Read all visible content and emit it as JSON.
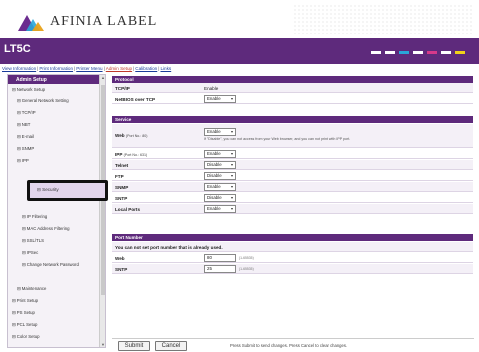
{
  "brand": {
    "name": "AFINIA LABEL"
  },
  "colors": {
    "primary": "#5e2a7c",
    "link": "#1a3c9a",
    "active_link": "#c0392b"
  },
  "header": {
    "model": "LT5C"
  },
  "nav": {
    "links": [
      "View Information",
      "Print Information",
      "Printer Menu",
      "Admin Setup",
      "Calibration",
      "Links"
    ],
    "active_index": 3
  },
  "sidebar": {
    "title": "Admin Setup",
    "items": [
      "⊟ Network Setup",
      "⊟ General Network Setting",
      "⊟ TCP/IP",
      "⊟ NBT",
      "⊟ E-mail",
      "⊟ SNMP",
      "⊟ IPP",
      "⊟ Security",
      "⊟ IP Filtering",
      "⊟ MAC Address Filtering",
      "⊟ SSL/TLS",
      "⊟ IPSec",
      "⊟ Change Network Password",
      "⊟ Maintenance",
      "⊟ Print Setup",
      "⊟ PS Setup",
      "⊟ PCL Setup",
      "⊟ Color Setup"
    ]
  },
  "protocol": {
    "title": "Protocol",
    "rows": [
      {
        "label": "TCP/IP",
        "value": "Enable"
      },
      {
        "label": "NetBIOS over TCP",
        "value": "Enable"
      }
    ]
  },
  "service": {
    "title": "Service",
    "web": {
      "label": "Web",
      "sub": "(Port No.: 80)",
      "value": "Enable",
      "note": "If \"Disable\", you can not access from your Web browser, and you can not print with IPP port."
    },
    "ipp": {
      "label": "IPP",
      "sub": "(Port No.: 631)",
      "value": "Enable"
    },
    "telnet": {
      "label": "Telnet",
      "value": "Disable"
    },
    "ftp": {
      "label": "FTP",
      "value": "Disable"
    },
    "snmp": {
      "label": "SNMP",
      "value": "Enable"
    },
    "sntp": {
      "label": "SNTP",
      "value": "Disable"
    },
    "local_ports": {
      "label": "Local Ports",
      "value": "Enable"
    }
  },
  "port_number": {
    "title": "Port Number",
    "message": "You can not set port number that is already used.",
    "web": {
      "label": "Web",
      "value": "80",
      "hint": "(1-65535)"
    },
    "sntp": {
      "label": "SNTP",
      "value": "25",
      "hint": "(1-65535)"
    }
  },
  "footer": {
    "submit": "Submit",
    "cancel": "Cancel",
    "note": "Press Submit to send changes. Press Cancel to clear changes."
  }
}
